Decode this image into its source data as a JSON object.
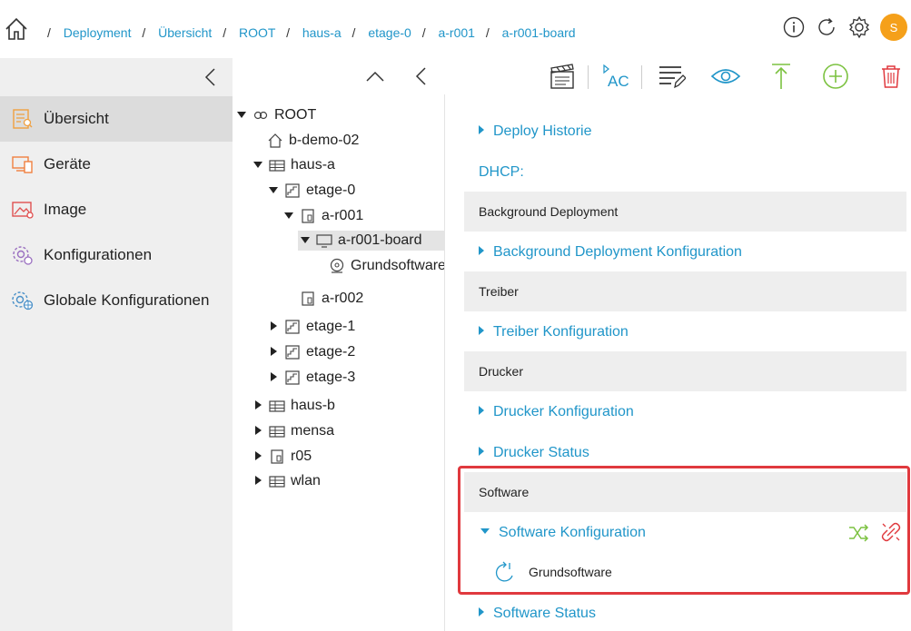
{
  "breadcrumb": {
    "home_icon": "home-icon",
    "items": [
      "Deployment",
      "Übersicht",
      "ROOT",
      "haus-a",
      "etage-0",
      "a-r001",
      "a-r001-board"
    ],
    "separator": "/"
  },
  "top_icons": [
    "info-icon",
    "refresh-icon",
    "settings-gear-icon"
  ],
  "avatar": {
    "initial": "S",
    "color": "#f5a01a"
  },
  "sidebar": {
    "items": [
      {
        "label": "Übersicht",
        "icon": "overview-icon",
        "active": true
      },
      {
        "label": "Geräte",
        "icon": "devices-icon",
        "active": false
      },
      {
        "label": "Image",
        "icon": "image-icon",
        "active": false
      },
      {
        "label": "Konfigurationen",
        "icon": "configurations-icon",
        "active": false
      },
      {
        "label": "Globale Konfigurationen",
        "icon": "global-configurations-icon",
        "active": false
      }
    ]
  },
  "tree": {
    "nodes": [
      {
        "label": "ROOT",
        "icon": "root-icon",
        "expanded": true
      },
      {
        "label": "b-demo-02",
        "icon": "house-icon"
      },
      {
        "label": "haus-a",
        "icon": "building-icon",
        "expanded": true
      },
      {
        "label": "etage-0",
        "icon": "floor-icon",
        "expanded": true
      },
      {
        "label": "a-r001",
        "icon": "room-icon",
        "expanded": true
      },
      {
        "label": "a-r001-board",
        "icon": "monitor-icon",
        "expanded": true,
        "selected": true
      },
      {
        "label": "Grundsoftware",
        "icon": "software-icon"
      },
      {
        "label": "a-r002",
        "icon": "room-icon"
      },
      {
        "label": "etage-1",
        "icon": "floor-icon",
        "expanded": false
      },
      {
        "label": "etage-2",
        "icon": "floor-icon",
        "expanded": false
      },
      {
        "label": "etage-3",
        "icon": "floor-icon",
        "expanded": false
      },
      {
        "label": "haus-b",
        "icon": "building-icon",
        "expanded": false
      },
      {
        "label": "mensa",
        "icon": "building-icon",
        "expanded": false
      },
      {
        "label": "r05",
        "icon": "room-icon",
        "expanded": false
      },
      {
        "label": "wlan",
        "icon": "building-icon",
        "expanded": false
      }
    ]
  },
  "toolbar": {
    "ac_label": "AC",
    "icons": [
      "clapperboard-icon",
      "ac-text-icon",
      "list-edit-icon",
      "eye-icon",
      "upload-arrow-icon",
      "add-circle-icon",
      "trash-icon"
    ],
    "colors": {
      "blue": "#2196c9",
      "green": "#7cc241",
      "red": "#e0393e"
    }
  },
  "main": {
    "rows": {
      "deploy_historie": "Deploy Historie",
      "dhcp": "DHCP:",
      "background_hdr": "Background Deployment",
      "background_cfg": "Background Deployment Konfiguration",
      "treiber_hdr": "Treiber",
      "treiber_cfg": "Treiber Konfiguration",
      "drucker_hdr": "Drucker",
      "drucker_cfg": "Drucker Konfiguration",
      "drucker_status": "Drucker Status",
      "software_hdr": "Software",
      "software_cfg": "Software Konfiguration",
      "software_item": "Grundsoftware",
      "software_status": "Software Status"
    },
    "software_actions": [
      "shuffle-icon",
      "unlink-icon"
    ]
  }
}
